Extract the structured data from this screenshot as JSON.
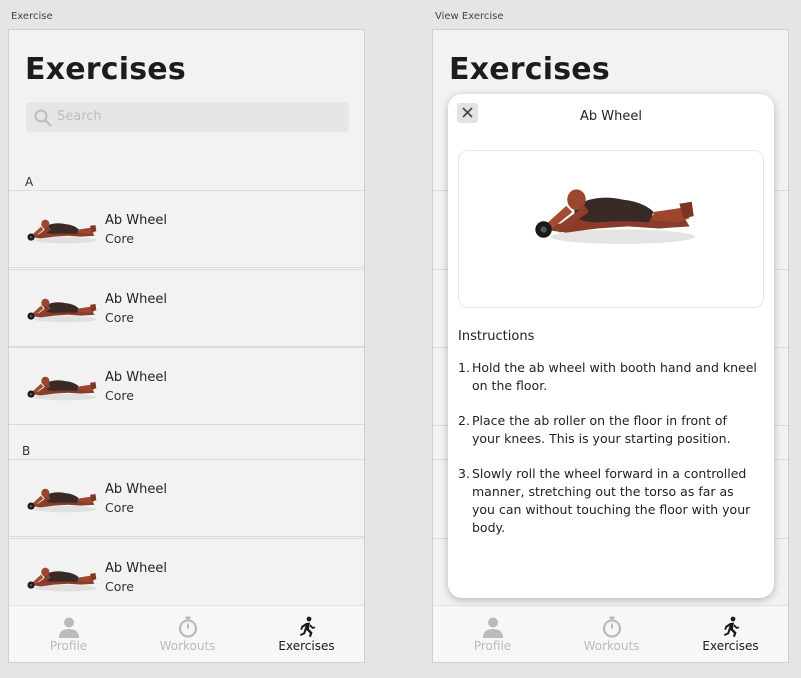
{
  "frames": {
    "left_label": "Exercise",
    "right_label": "View Exercise"
  },
  "page_title": "Exercises",
  "search": {
    "placeholder": "Search"
  },
  "sections": [
    {
      "letter": "A",
      "items": [
        {
          "name": "Ab Wheel",
          "category": "Core"
        },
        {
          "name": "Ab Wheel",
          "category": "Core"
        },
        {
          "name": "Ab Wheel",
          "category": "Core"
        }
      ]
    },
    {
      "letter": "B",
      "items": [
        {
          "name": "Ab Wheel",
          "category": "Core"
        },
        {
          "name": "Ab Wheel",
          "category": "Core"
        }
      ]
    }
  ],
  "tabbar": {
    "tabs": [
      {
        "label": "Profile",
        "icon": "person-icon",
        "active": false
      },
      {
        "label": "Workouts",
        "icon": "stopwatch-icon",
        "active": false
      },
      {
        "label": "Exercises",
        "icon": "running-icon",
        "active": true
      }
    ]
  },
  "modal": {
    "title": "Ab Wheel",
    "instructions_title": "Instructions",
    "steps": [
      {
        "num": "1.",
        "text": "Hold the ab wheel with booth hand and kneel on the floor."
      },
      {
        "num": "2.",
        "text": "Place the ab roller on the floor in front of your knees. This is your starting position."
      },
      {
        "num": "3.",
        "text": "Slowly roll the wheel forward in a controlled manner, stretching out the torso as far as you can without touching the floor with your body."
      }
    ]
  },
  "colors": {
    "background": "#e5e5e5",
    "screen": "#f2f2f2",
    "active_tab": "#1a1a1a",
    "inactive_tab": "#bbbbbb"
  }
}
